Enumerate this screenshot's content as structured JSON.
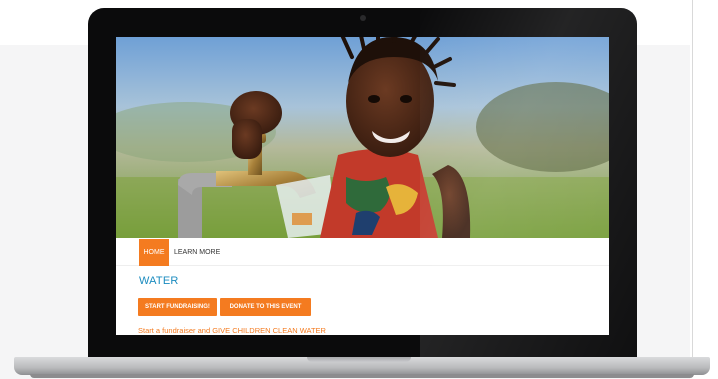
{
  "nav": {
    "home_label": "HOME",
    "learn_more_label": "LEARN MORE"
  },
  "page": {
    "title": "WATER",
    "tagline": "Start a fundraiser and GIVE CHILDREN CLEAN WATER"
  },
  "buttons": {
    "start_fundraising": "START FUNDRAISING!",
    "donate": "DONATE TO THIS EVENT"
  },
  "hero": {
    "description_icon": "photo-child-at-tap"
  },
  "colors": {
    "accent_orange": "#f47b20",
    "title_blue": "#1a8bbf",
    "laptop_bezel": "#0b0b0c",
    "page_background": "#f5f5f6"
  }
}
